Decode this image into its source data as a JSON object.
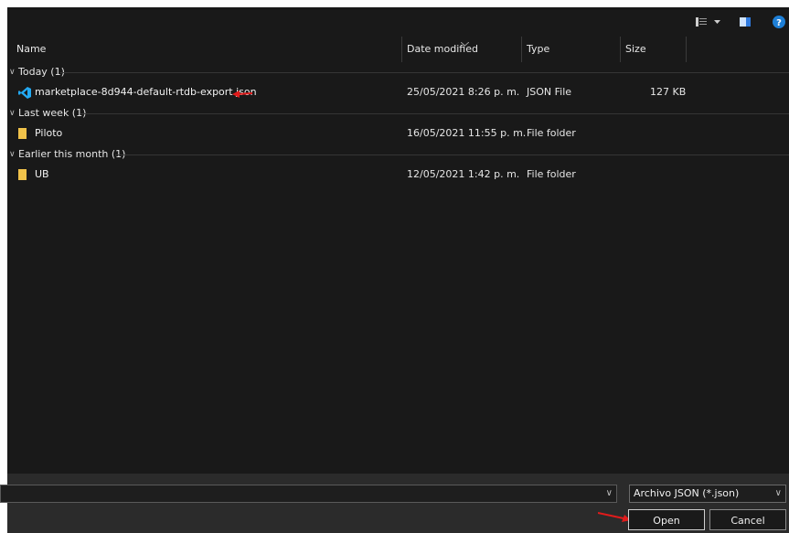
{
  "columns": {
    "name": "Name",
    "date": "Date modified",
    "type": "Type",
    "size": "Size"
  },
  "groups": [
    {
      "label": "Today (1)",
      "items": [
        {
          "name": "marketplace-8d944-default-rtdb-export.json",
          "date": "25/05/2021 8:26 p. m.",
          "type": "JSON File",
          "size": "127 KB",
          "icon": "vscode-icon"
        }
      ]
    },
    {
      "label": "Last week (1)",
      "items": [
        {
          "name": "Piloto",
          "date": "16/05/2021 11:55 p. m.",
          "type": "File folder",
          "size": "",
          "icon": "folder-icon"
        }
      ]
    },
    {
      "label": "Earlier this month (1)",
      "items": [
        {
          "name": "UB",
          "date": "12/05/2021 1:42 p. m.",
          "type": "File folder",
          "size": "",
          "icon": "folder-icon"
        }
      ]
    }
  ],
  "footer": {
    "filename_value": "",
    "filetype_selected": "Archivo JSON (*.json)",
    "open_label": "Open",
    "cancel_label": "Cancel"
  },
  "colors": {
    "background": "#191919",
    "footer": "#2b2b2b",
    "help": "#1e7fd6",
    "vscode": "#23a9f2",
    "folder": "#f0c24a",
    "annotation": "#e11b1b"
  }
}
